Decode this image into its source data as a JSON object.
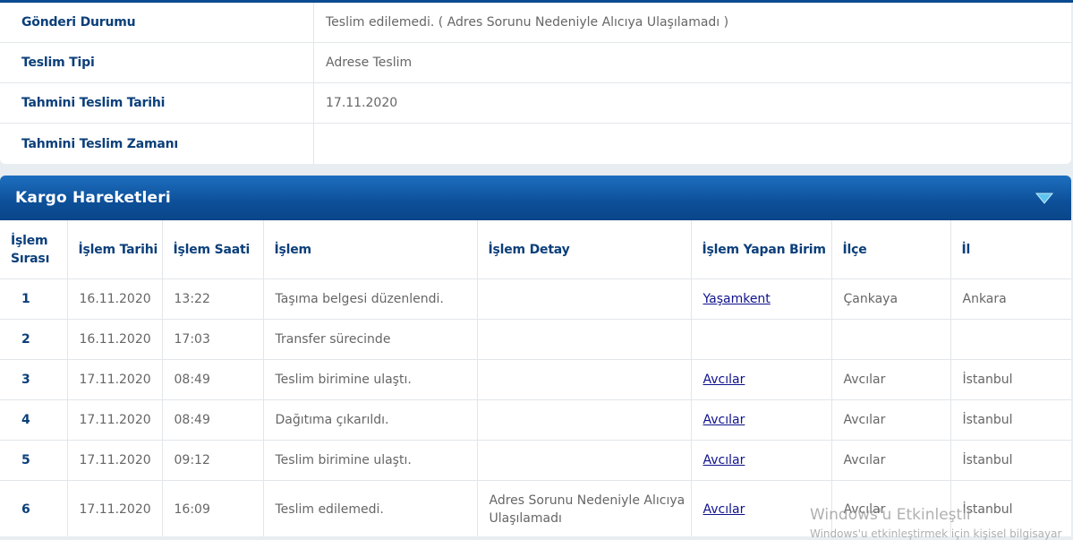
{
  "info": [
    {
      "label": "Gönderi Durumu",
      "value": "Teslim edilemedi. ( Adres Sorunu Nedeniyle Alıcıya Ulaşılamadı )"
    },
    {
      "label": "Teslim Tipi",
      "value": "Adrese Teslim"
    },
    {
      "label": "Tahmini Teslim Tarihi",
      "value": "17.11.2020"
    },
    {
      "label": "Tahmini Teslim Zamanı",
      "value": ""
    }
  ],
  "section": {
    "title": "Kargo Hareketleri",
    "icon": "chevron-down-icon"
  },
  "moves": {
    "headers": {
      "sira": "İşlem Sırası",
      "tarih": "İşlem Tarihi",
      "saat": "İşlem Saati",
      "islem": "İşlem",
      "detay": "İşlem Detay",
      "birim": "İşlem Yapan Birim",
      "ilce": "İlçe",
      "il": "İl"
    },
    "rows": [
      {
        "sira": "1",
        "tarih": "16.11.2020",
        "saat": "13:22",
        "islem": "Taşıma belgesi düzenlendi.",
        "detay": "",
        "birim": "Yaşamkent",
        "ilce": "Çankaya",
        "il": "Ankara"
      },
      {
        "sira": "2",
        "tarih": "16.11.2020",
        "saat": "17:03",
        "islem": "Transfer sürecinde",
        "detay": "",
        "birim": "",
        "ilce": "",
        "il": ""
      },
      {
        "sira": "3",
        "tarih": "17.11.2020",
        "saat": "08:49",
        "islem": "Teslim birimine ulaştı.",
        "detay": "",
        "birim": "Avcılar",
        "ilce": "Avcılar",
        "il": "İstanbul"
      },
      {
        "sira": "4",
        "tarih": "17.11.2020",
        "saat": "08:49",
        "islem": "Dağıtıma çıkarıldı.",
        "detay": "",
        "birim": "Avcılar",
        "ilce": "Avcılar",
        "il": "İstanbul"
      },
      {
        "sira": "5",
        "tarih": "17.11.2020",
        "saat": "09:12",
        "islem": "Teslim birimine ulaştı.",
        "detay": "",
        "birim": "Avcılar",
        "ilce": "Avcılar",
        "il": "İstanbul"
      },
      {
        "sira": "6",
        "tarih": "17.11.2020",
        "saat": "16:09",
        "islem": "Teslim edilemedi.",
        "detay": "Adres Sorunu Nedeniyle Alıcıya Ulaşılamadı",
        "birim": "Avcılar",
        "ilce": "Avcılar",
        "il": "İstanbul"
      }
    ]
  },
  "watermark": {
    "title": "Windows'u Etkinleştir",
    "subtitle": "Windows'u etkinleştirmek için kişisel bilgisayar"
  },
  "colors": {
    "accent": "#0b3f7a",
    "header_bg": "#0d4f98",
    "link": "#10128c"
  }
}
